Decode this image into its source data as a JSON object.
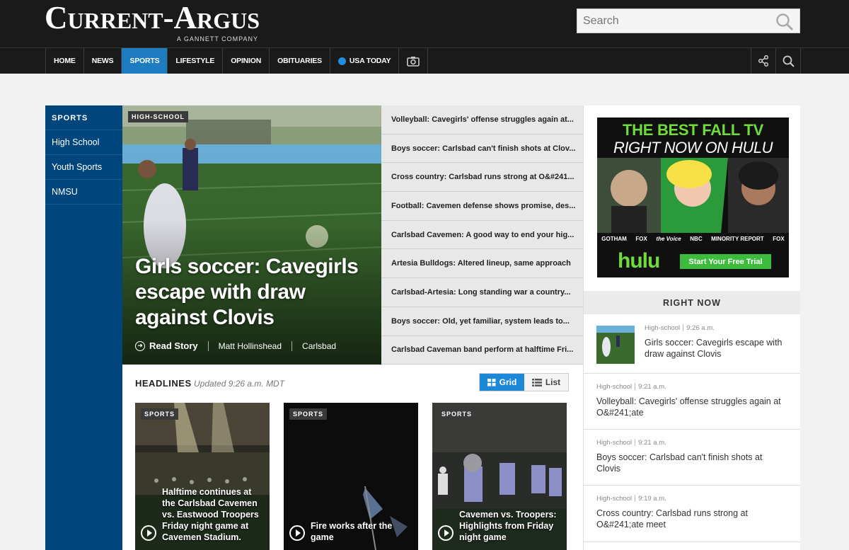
{
  "masthead": {
    "logo": "Current-Argus",
    "logo_sub": "A GANNETT COMPANY",
    "search_placeholder": "Search"
  },
  "nav": {
    "items": [
      "HOME",
      "NEWS",
      "SPORTS",
      "LIFESTYLE",
      "OPINION",
      "OBITUARIES",
      "USA TODAY"
    ],
    "active": "SPORTS"
  },
  "sports_nav": {
    "title": "SPORTS",
    "items": [
      "High School",
      "Youth Sports",
      "NMSU"
    ]
  },
  "hero": {
    "tag": "HIGH-SCHOOL",
    "title": "Girls soccer: Cavegirls escape with draw against Clovis",
    "read_story": "Read Story",
    "author": "Matt Hollinshead",
    "location": "Carlsbad"
  },
  "headline_list": [
    "Volleyball: Cavegirls' offense struggles again at...",
    "Boys soccer: Carlsbad can't finish shots at Clov...",
    "Cross country: Carlsbad runs strong at O&#241...",
    "Football: Cavemen defense shows promise, des...",
    "Carlsbad Cavemen: A good way to end your hig...",
    "Artesia Bulldogs: Altered lineup, same approach",
    "Carlsbad-Artesia: Long standing war a country...",
    "Boys soccer: Old, yet familiar, system leads to...",
    "Carlsbad Caveman band perform at halftime Fri..."
  ],
  "headlines": {
    "title": "HEADLINES",
    "updated": "Updated 9:26 a.m. MDT",
    "grid_label": "Grid",
    "list_label": "List",
    "cards": [
      {
        "tag": "SPORTS",
        "caption": "Halftime continues at the Carlsbad Cavemen vs. Eastwood Troopers Friday night game at Cavemen Stadium."
      },
      {
        "tag": "SPORTS",
        "caption": "Fire works after the game"
      },
      {
        "tag": "SPORTS",
        "caption": "Cavemen vs. Troopers: Highlights from Friday night game"
      }
    ]
  },
  "ad": {
    "line1": "THE BEST FALL TV",
    "line2": "RIGHT NOW ON HULU",
    "shows": [
      "GOTHAM",
      "FOX",
      "the Voice",
      "NBC",
      "MINORITY REPORT",
      "FOX"
    ],
    "brand": "hulu",
    "cta": "Start Your Free Trial"
  },
  "right_now": {
    "title": "RIGHT NOW",
    "items": [
      {
        "category": "High-school",
        "time": "9:26 a.m.",
        "text": "Girls soccer: Cavegirls escape with draw against Clovis"
      },
      {
        "category": "High-school",
        "time": "9:21 a.m.",
        "text": "Volleyball: Cavegirls' offense struggles again at O&#241;ate"
      },
      {
        "category": "High-school",
        "time": "9:21 a.m.",
        "text": "Boys soccer: Carlsbad can't finish shots at Clovis"
      },
      {
        "category": "High-school",
        "time": "9:19 a.m.",
        "text": "Cross country: Carlsbad runs strong at O&#241;ate meet"
      }
    ]
  },
  "colors": {
    "masthead": "#1a1a1a",
    "active_nav": "#1e7dc1",
    "sports_nav": "#00457c",
    "hulu_green": "#6fdc3c"
  }
}
